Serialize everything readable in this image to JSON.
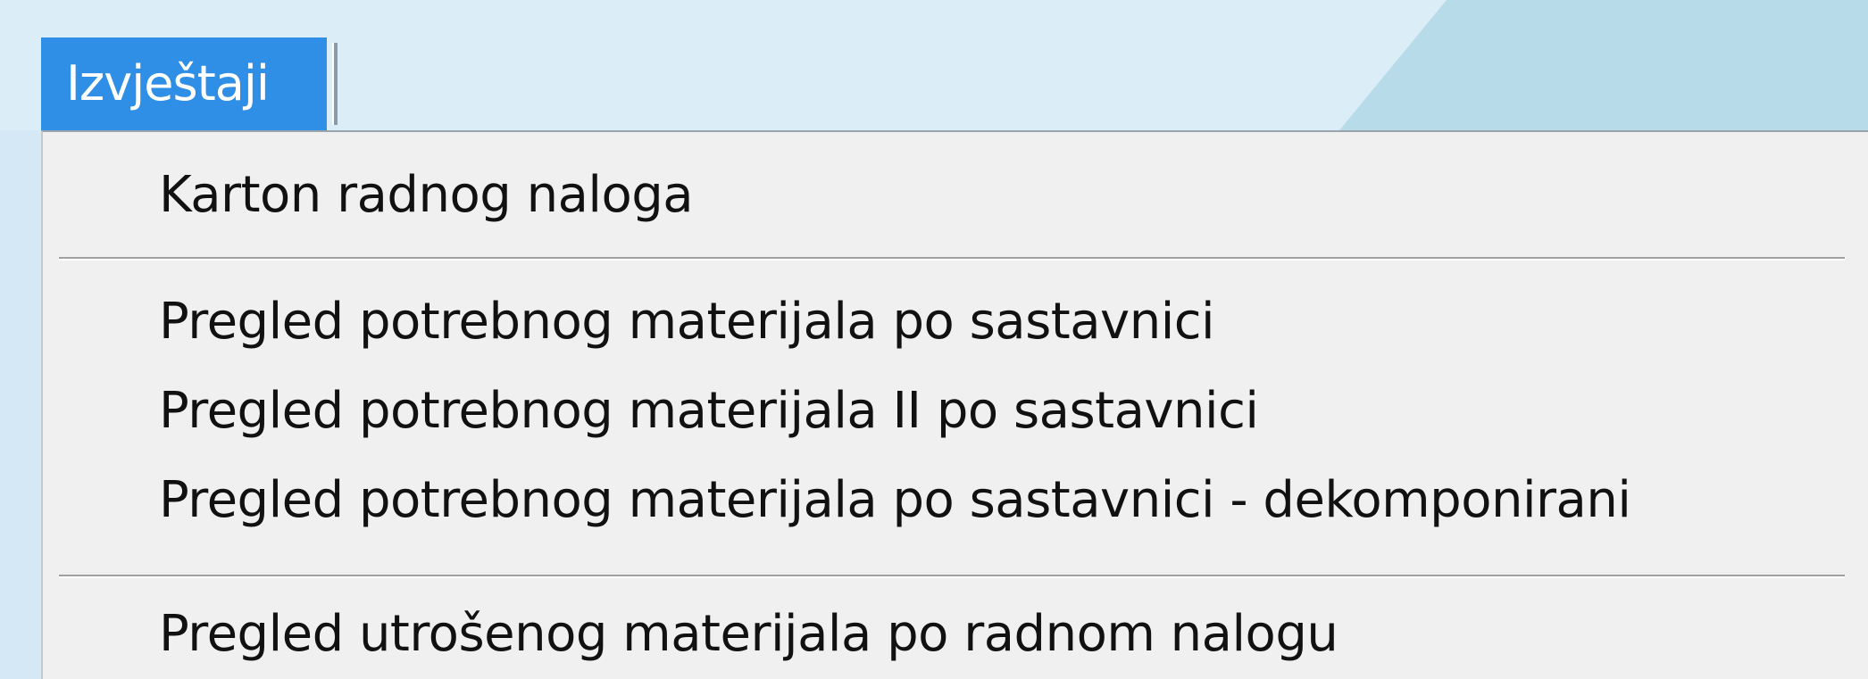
{
  "menu": {
    "title": "Izvještaji",
    "items": [
      {
        "label": "Karton radnog naloga"
      },
      {
        "label": "Pregled potrebnog materijala po sastavnici"
      },
      {
        "label": "Pregled potrebnog materijala II po sastavnici"
      },
      {
        "label": "Pregled potrebnog materijala po sastavnici - dekomponirani"
      },
      {
        "label": "Pregled utrošenog materijala po radnom nalogu"
      }
    ]
  },
  "colors": {
    "menu_highlight": "#2f8ee6",
    "menu_background": "#f0f0f0",
    "window_background": "#d6eaf5"
  }
}
